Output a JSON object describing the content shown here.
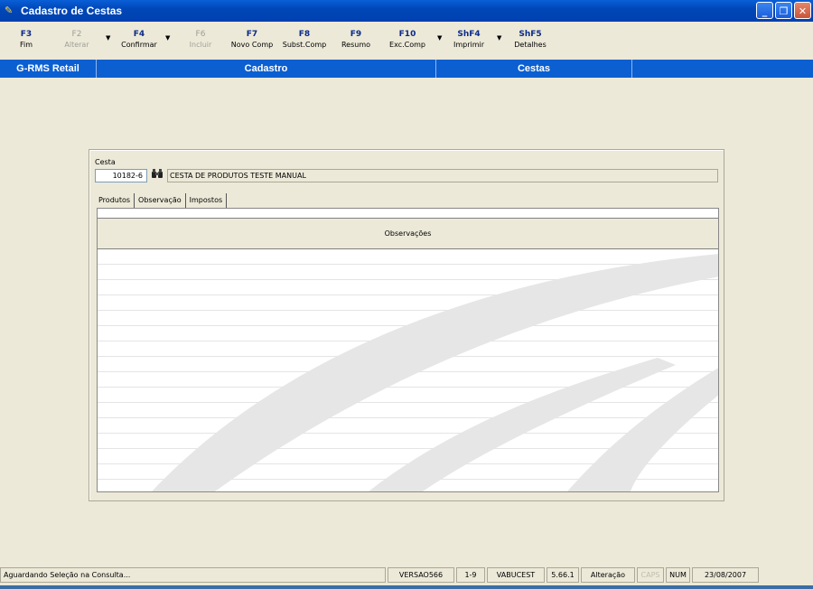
{
  "window": {
    "title": "Cadastro de Cestas"
  },
  "toolbar": [
    {
      "key": "F3",
      "label": "Fim",
      "enabled": true
    },
    {
      "key": "F2",
      "label": "Alterar",
      "enabled": false
    },
    {
      "key": "F4",
      "label": "Confirmar",
      "enabled": true
    },
    {
      "key": "F6",
      "label": "Incluir",
      "enabled": false
    },
    {
      "key": "F7",
      "label": "Novo Comp",
      "enabled": true
    },
    {
      "key": "F8",
      "label": "Subst.Comp",
      "enabled": true
    },
    {
      "key": "F9",
      "label": "Resumo",
      "enabled": true
    },
    {
      "key": "F10",
      "label": "Exc.Comp",
      "enabled": true
    },
    {
      "key": "ShF4",
      "label": "Imprimir",
      "enabled": true
    },
    {
      "key": "ShF5",
      "label": "Detalhes",
      "enabled": true
    }
  ],
  "context_bar": {
    "app": "G-RMS Retail",
    "module": "Cadastro",
    "entity": "Cestas"
  },
  "form": {
    "cesta_label": "Cesta",
    "cesta_code": "10182-6",
    "cesta_description": "CESTA DE PRODUTOS TESTE MANUAL"
  },
  "tabs": [
    {
      "label": "Produtos",
      "active": false
    },
    {
      "label": "Observação",
      "active": true
    },
    {
      "label": "Impostos",
      "active": false
    }
  ],
  "observations": {
    "header": "Observações"
  },
  "statusbar": {
    "message": "Aguardando Seleção na Consulta...",
    "version": "VERSAO566",
    "page": "1-9",
    "user": "VABUCEST",
    "build": "5.66.1",
    "mode": "Alteração",
    "caps": "CAPS",
    "num": "NUM",
    "date": "23/08/2007"
  },
  "icons": {
    "app": "app-icon",
    "search": "binoculars-icon",
    "minimize": "minimize-icon",
    "restore": "restore-icon",
    "close": "close-icon"
  }
}
